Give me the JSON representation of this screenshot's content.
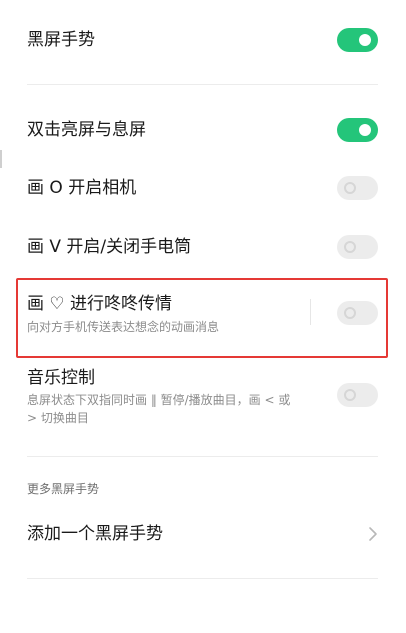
{
  "gestures": {
    "master": {
      "title": "黑屏手势",
      "enabled": true
    },
    "double_tap": {
      "title": "双击亮屏与息屏",
      "enabled": true
    },
    "draw_o": {
      "title": "画 O 开启相机",
      "enabled": false
    },
    "draw_v": {
      "title": "画 V 开启/关闭手电筒",
      "enabled": false
    },
    "draw_heart": {
      "title": "画 ♡ 进行咚咚传情",
      "subtitle": "向对方手机传送表达想念的动画消息",
      "enabled": false
    },
    "music_control": {
      "title": "音乐控制",
      "subtitle_line1": "息屏状态下双指同时画 ‖ 暂停/播放曲目，画 < 或",
      "subtitle_line2": "> 切换曲目",
      "enabled": false
    }
  },
  "more_section": {
    "header": "更多黑屏手势",
    "add_gesture_label": "添加一个黑屏手势"
  },
  "colors": {
    "toggle_on": "#24c57a",
    "toggle_off": "#ececec",
    "highlight_border": "#e53935",
    "subtitle_text": "#8c8c8c"
  }
}
